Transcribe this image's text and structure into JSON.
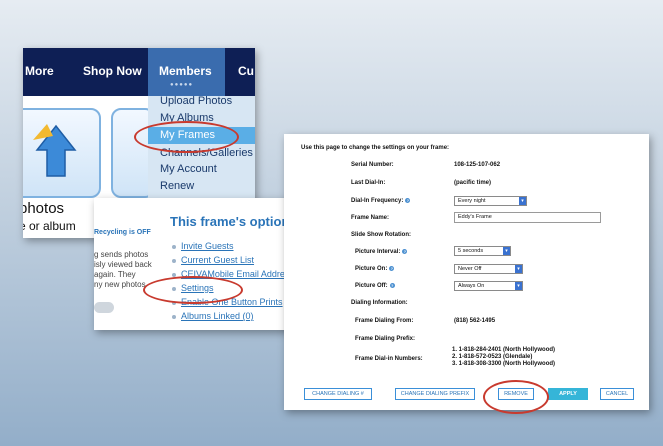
{
  "panel_menu": {
    "nav_items": [
      "More",
      "Shop Now",
      "Members",
      "Cu"
    ],
    "dropdown_items": [
      "Upload Photos",
      "My Albums",
      "My Frames",
      "Channels/Galleries",
      "My Account",
      "Renew"
    ],
    "tile_text_line1": "photos",
    "tile_text_line2": "e or album"
  },
  "panel_options": {
    "recycling_label": "Recycling is OFF",
    "body_lines": [
      "g sends photos",
      "isly viewed back",
      "again. They",
      "ny new photos"
    ],
    "title": "This frame's options",
    "options": [
      "Invite Guests",
      "Current Guest List",
      "CEIVAMobile Email Address",
      "Settings",
      "Enable One Button Prints",
      "Albums Linked (0)"
    ]
  },
  "panel_settings": {
    "intro": "Use this page to change the settings on your frame:",
    "serial_label": "Serial Number:",
    "serial_value": "108-125-107-062",
    "last_dialin_label": "Last Dial-In:",
    "last_dialin_value": "(pacific time)",
    "dialin_freq_label": "Dial-In Frequency:",
    "dialin_freq_value": "Every night",
    "frame_name_label": "Frame Name:",
    "frame_name_value": "Eddy's Frame",
    "slideshow_label": "Slide Show Rotation:",
    "picture_interval_label": "Picture Interval:",
    "picture_interval_value": "5 seconds",
    "picture_on_label": "Picture On:",
    "picture_on_value": "Never Off",
    "picture_off_label": "Picture Off:",
    "picture_off_value": "Always On",
    "dialing_info_label": "Dialing Information:",
    "dialing_from_label": "Frame Dialing From:",
    "dialing_from_value": "(818) 562-1495",
    "dialing_prefix_label": "Frame Dialing Prefix:",
    "dialin_numbers_label": "Frame Dial-in Numbers:",
    "dialin_numbers": [
      "1. 1-818-284-2401 (North Hollywood)",
      "2. 1-818-572-0523 (Glendale)",
      "3. 1-818-308-3300 (North Hollywood)"
    ],
    "buttons": {
      "change_dialing": "CHANGE DIALING #",
      "change_prefix": "CHANGE DIALING PREFIX",
      "remove": "REMOVE",
      "apply": "APPLY",
      "cancel": "CANCEL"
    }
  },
  "colors": {
    "navy": "#0e1f55",
    "accent_blue": "#2a74b8",
    "highlight_oval": "#c83a2e"
  }
}
